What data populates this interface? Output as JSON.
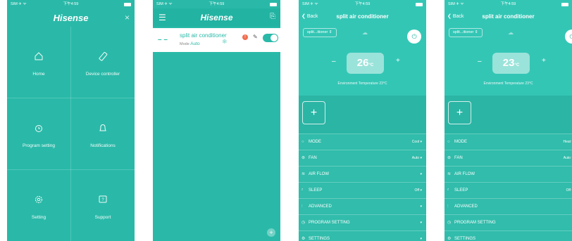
{
  "status": {
    "carrier": "SIM ✈ ᯤ",
    "time": "下午4:59"
  },
  "p1": {
    "brand": "Hisense",
    "close": "×",
    "items": [
      {
        "label": "Home",
        "icon": "home-icon",
        "glyph": "⌂"
      },
      {
        "label": "Device controller",
        "icon": "remote-icon",
        "glyph": "▭"
      },
      {
        "label": "Program setting",
        "icon": "alarm-clock-icon",
        "glyph": "⏰"
      },
      {
        "label": "Notifications",
        "icon": "bell-icon",
        "glyph": "🔔"
      },
      {
        "label": "Setting",
        "icon": "gear-icon",
        "glyph": "⚙"
      },
      {
        "label": "Support",
        "icon": "question-icon",
        "glyph": "?"
      }
    ]
  },
  "p2": {
    "brand": "Hisense",
    "menu": "☰",
    "exit": "⎘",
    "device": "split air conditioner",
    "dash": "– –",
    "mode_label": "Mode",
    "mode": "Auto",
    "snow": "❄",
    "warn": "!",
    "edit": "✎",
    "fab": "+"
  },
  "p3": {
    "back": "Back",
    "title": "split air conditioner",
    "device": "split...itioner",
    "temp": "26",
    "unit": "°C",
    "env": "Environment Temperature 23°C",
    "mode_value": "Cool",
    "fan_value": "Auto",
    "sleep_value": "Off"
  },
  "p4": {
    "back": "Back",
    "title": "split air conditioner",
    "device": "split...itioner",
    "temp": "23",
    "unit": "°C",
    "env": "Environment Temperature 23°C",
    "mode_value": "Heat",
    "fan_value": "Auto",
    "sleep_value": "Off"
  },
  "rows": [
    "MODE",
    "FAN",
    "AIR FLOW",
    "SLEEP",
    "ADVANCED",
    "PROGRAM SETTING",
    "SETTINGS"
  ],
  "controls": {
    "minus": "–",
    "plus": "+",
    "add": "+",
    "back_arrow": "❮",
    "power": "⏻",
    "cloud": "☁",
    "arrow": "▾"
  }
}
